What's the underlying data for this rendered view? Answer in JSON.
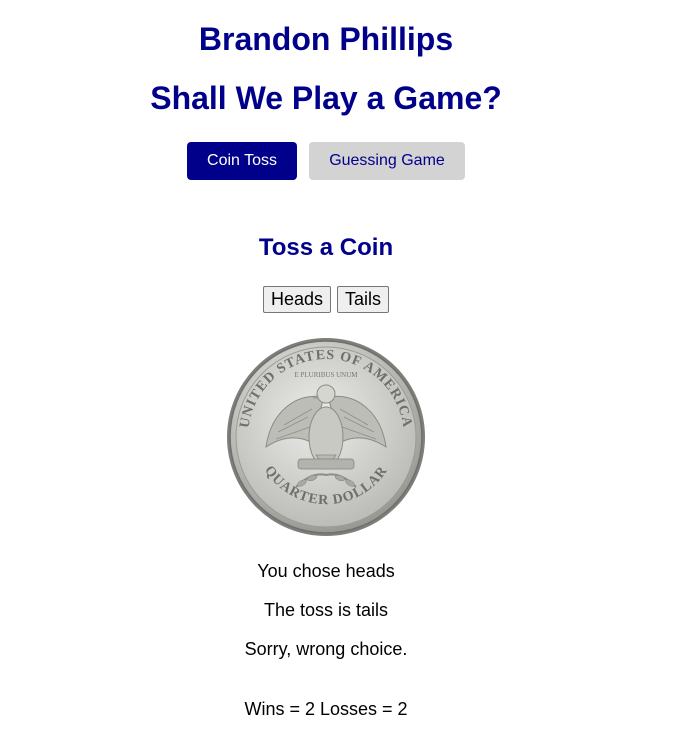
{
  "header": {
    "name": "Brandon Phillips",
    "subtitle": "Shall We Play a Game?"
  },
  "nav": {
    "coin_toss_label": "Coin Toss",
    "guessing_game_label": "Guessing Game",
    "active": "Coin Toss"
  },
  "game": {
    "title": "Toss a Coin",
    "heads_label": "Heads",
    "tails_label": "Tails",
    "coin_image": "quarter-tails-icon",
    "coin_text_top": "UNITED STATES OF AMERICA",
    "coin_text_bottom": "QUARTER DOLLAR",
    "coin_motto": "E PLURIBUS UNUM",
    "choice_text": "You chose heads",
    "toss_text": "The toss is tails",
    "outcome_text": "Sorry, wrong choice.",
    "score_text": "Wins = 2 Losses = 2"
  },
  "colors": {
    "primary": "#00008b",
    "inactive_button": "#d3d3d3"
  }
}
